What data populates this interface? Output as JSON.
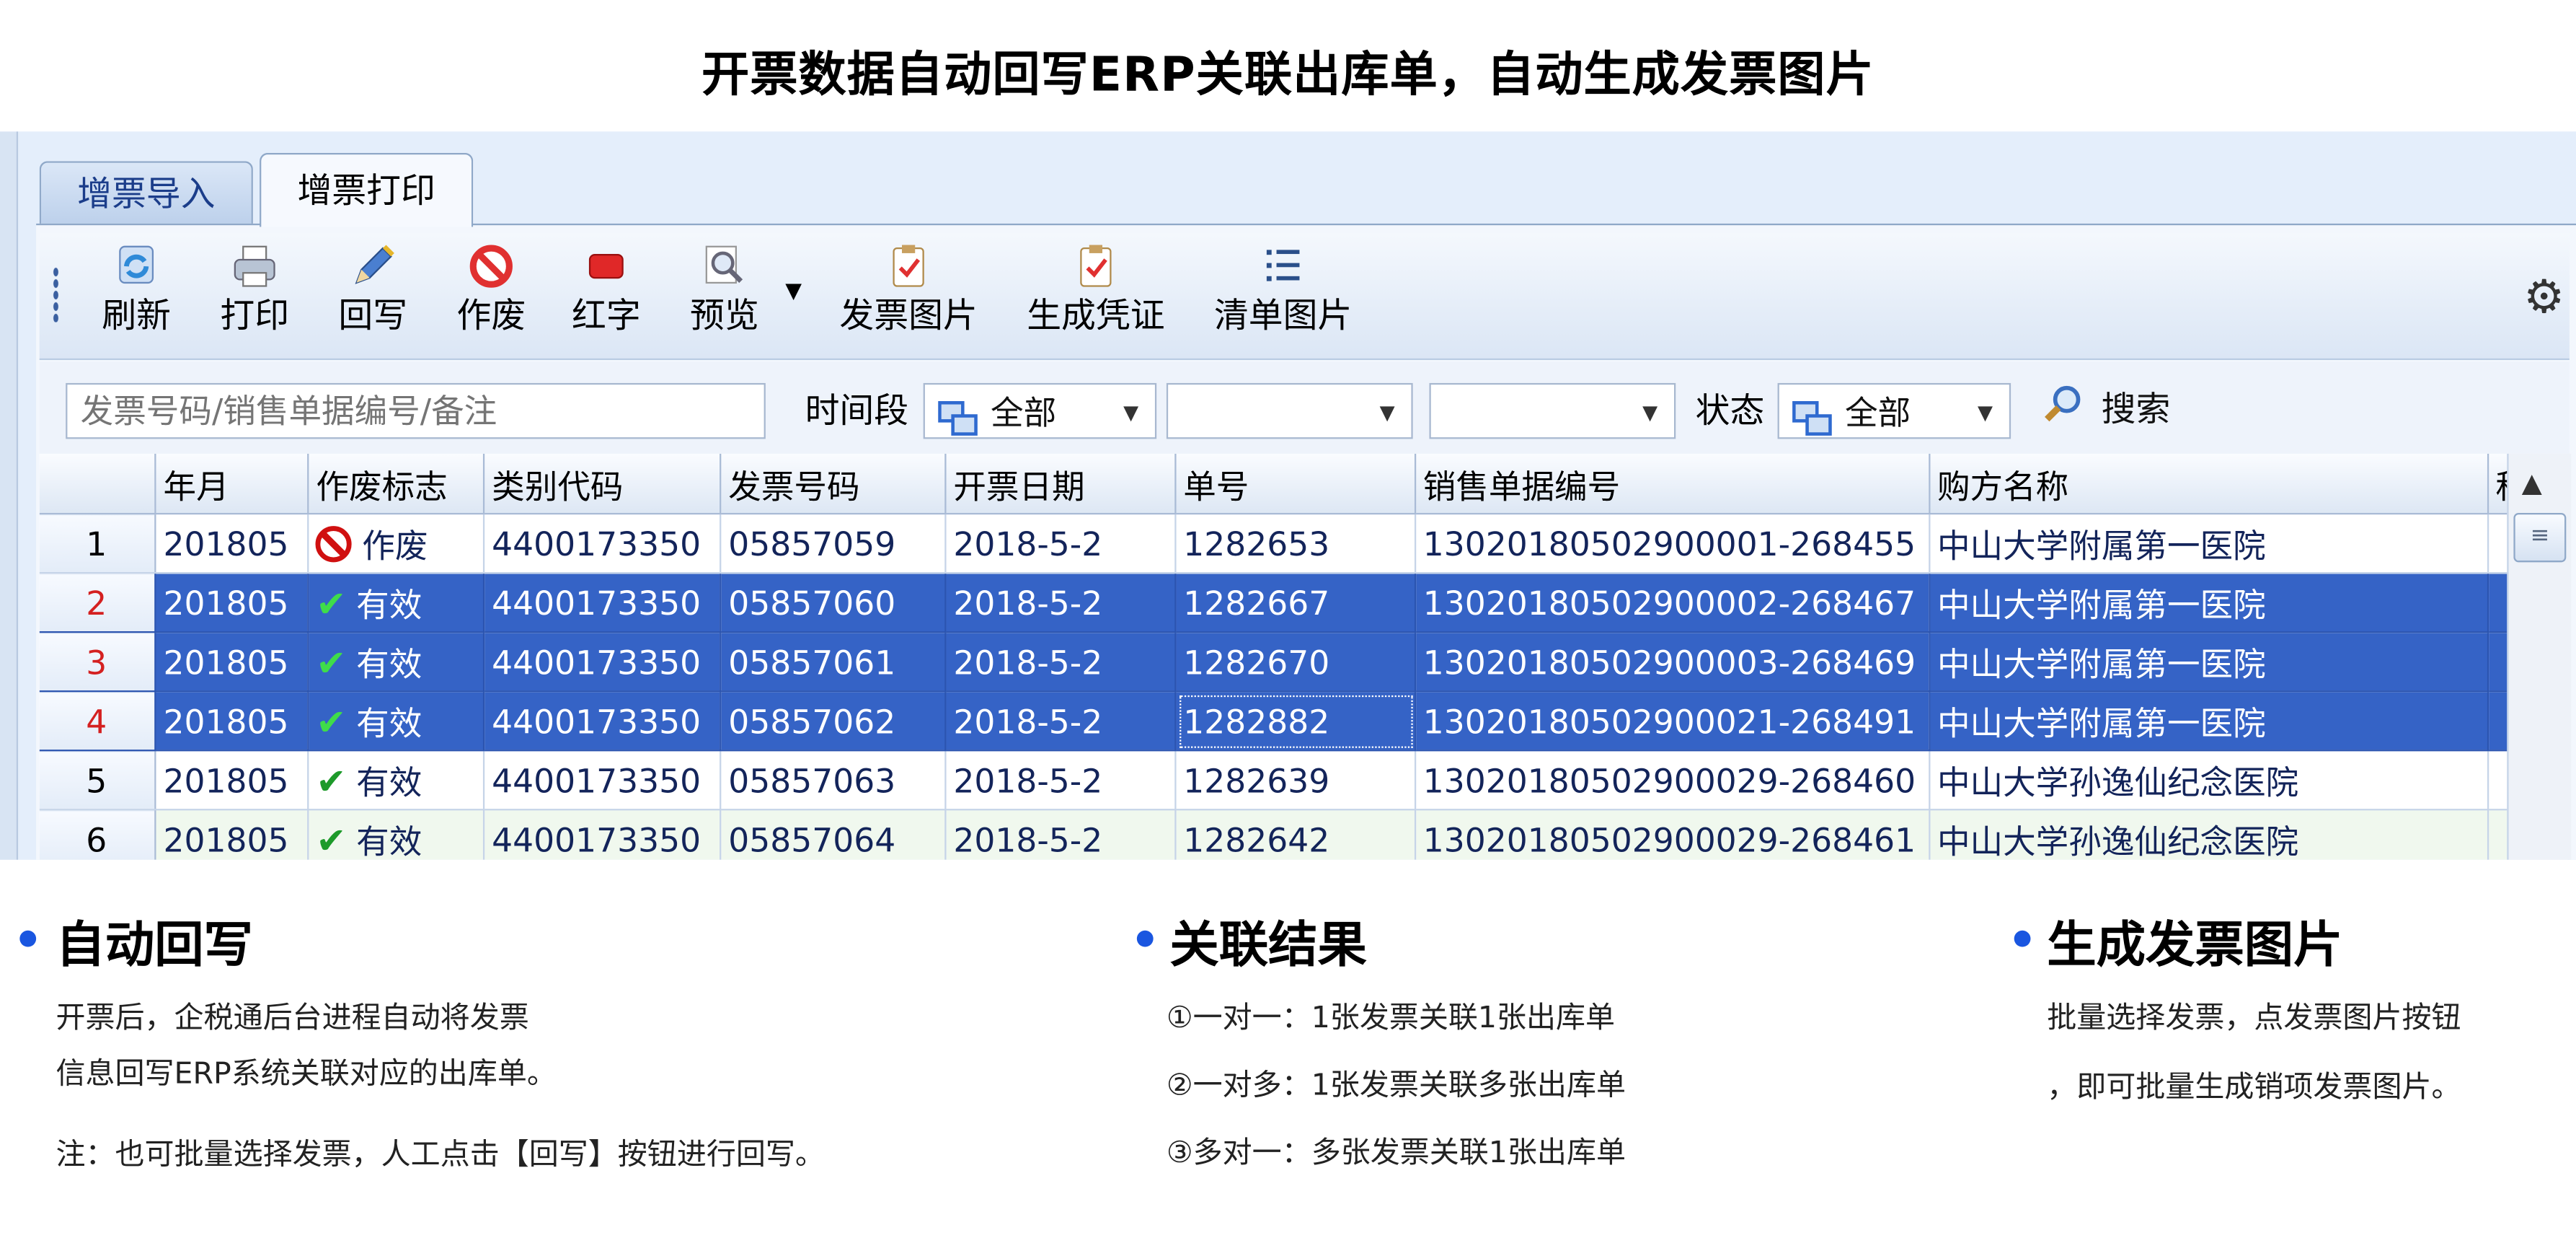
{
  "title": "开票数据自动回写ERP关联出库单，自动生成发票图片",
  "tabs": [
    {
      "label": "增票导入",
      "active": false
    },
    {
      "label": "增票打印",
      "active": true
    }
  ],
  "toolbar": {
    "buttons": [
      {
        "label": "刷新",
        "icon": "refresh-icon"
      },
      {
        "label": "打印",
        "icon": "printer-icon"
      },
      {
        "label": "回写",
        "icon": "pen-icon"
      },
      {
        "label": "作废",
        "icon": "forbidden-icon"
      },
      {
        "label": "红字",
        "icon": "red-block-icon"
      },
      {
        "label": "预览",
        "icon": "magnifier-icon"
      },
      {
        "label": "发票图片",
        "icon": "clipboard-check-icon"
      },
      {
        "label": "生成凭证",
        "icon": "clipboard-check-icon"
      },
      {
        "label": "清单图片",
        "icon": "list-icon"
      }
    ],
    "settings_icon": "gear-icon"
  },
  "search": {
    "placeholder": "发票号码/销售单据编号/备注",
    "time_label": "时间段",
    "time_value": "全部",
    "date_from": "",
    "date_to": "",
    "status_label": "状态",
    "status_value": "全部",
    "search_label": "搜索"
  },
  "grid": {
    "columns": [
      "年月",
      "作废标志",
      "类别代码",
      "发票号码",
      "开票日期",
      "单号",
      "销售单据编号",
      "购方名称",
      "税"
    ],
    "rows": [
      {
        "num": "1",
        "ym": "201805",
        "flag": "作废",
        "flag_type": "void",
        "code": "4400173350",
        "invoice": "05857059",
        "date": "2018-5-2",
        "no": "1282653",
        "sale_no": "13020180502900001-268455",
        "buyer": "中山大学附属第一医院",
        "selected": false
      },
      {
        "num": "2",
        "ym": "201805",
        "flag": "有效",
        "flag_type": "valid",
        "code": "4400173350",
        "invoice": "05857060",
        "date": "2018-5-2",
        "no": "1282667",
        "sale_no": "13020180502900002-268467",
        "buyer": "中山大学附属第一医院",
        "selected": true
      },
      {
        "num": "3",
        "ym": "201805",
        "flag": "有效",
        "flag_type": "valid",
        "code": "4400173350",
        "invoice": "05857061",
        "date": "2018-5-2",
        "no": "1282670",
        "sale_no": "13020180502900003-268469",
        "buyer": "中山大学附属第一医院",
        "selected": true
      },
      {
        "num": "4",
        "ym": "201805",
        "flag": "有效",
        "flag_type": "valid",
        "code": "4400173350",
        "invoice": "05857062",
        "date": "2018-5-2",
        "no": "1282882",
        "sale_no": "13020180502900021-268491",
        "buyer": "中山大学附属第一医院",
        "selected": true
      },
      {
        "num": "5",
        "ym": "201805",
        "flag": "有效",
        "flag_type": "valid",
        "code": "4400173350",
        "invoice": "05857063",
        "date": "2018-5-2",
        "no": "1282639",
        "sale_no": "13020180502900029-268460",
        "buyer": "中山大学孙逸仙纪念医院",
        "selected": false
      },
      {
        "num": "6",
        "ym": "201805",
        "flag": "有效",
        "flag_type": "valid",
        "code": "4400173350",
        "invoice": "05857064",
        "date": "2018-5-2",
        "no": "1282642",
        "sale_no": "13020180502900029-268461",
        "buyer": "中山大学孙逸仙纪念医院",
        "selected": false
      }
    ]
  },
  "sections": {
    "writeback": {
      "title": "自动回写",
      "lines": [
        "开票后，企税通后台进程自动将发票",
        "信息回写ERP系统关联对应的出库单。"
      ],
      "note": "注：也可批量选择发票，人工点击【回写】按钮进行回写。"
    },
    "relation": {
      "title": "关联结果",
      "items": [
        "①一对一：1张发票关联1张出库单",
        "②一对多：1张发票关联多张出库单",
        "③多对一：多张发票关联1张出库单"
      ]
    },
    "image": {
      "title": "生成发票图片",
      "lines": [
        "批量选择发票，点发票图片按钮",
        "，即可批量生成销项发票图片。"
      ]
    }
  },
  "colors": {
    "accent_dot": "#1a56e0",
    "selection": "#3563c6",
    "void_red": "#d01010",
    "valid_green": "#1d9a2a"
  }
}
